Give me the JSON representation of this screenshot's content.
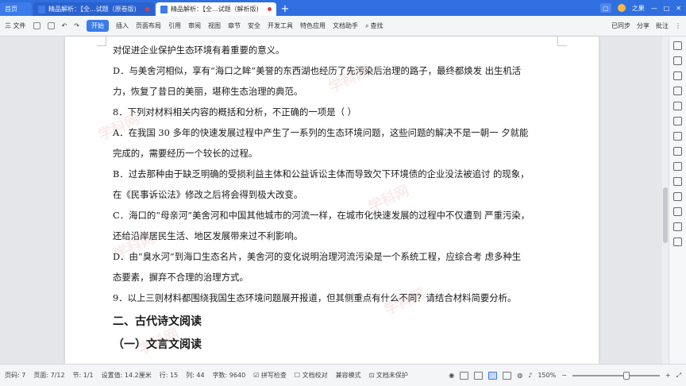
{
  "tabs": {
    "home": "首页",
    "doc1": "精品解析：【全...试题（原卷版)",
    "doc2": "精品解析：【全...试题（解析版)",
    "plus": "+",
    "user": "之果"
  },
  "menu": {
    "file": "三 文件",
    "items": [
      "开始",
      "插入",
      "页面布局",
      "引用",
      "审阅",
      "视图",
      "章节",
      "安全",
      "开发工具",
      "特色应用",
      "文档助手"
    ],
    "search": "查找",
    "right": [
      "已同步",
      "分享",
      "批注"
    ]
  },
  "document": {
    "lines": [
      "对促进企业保护生态环境有着重要的意义。",
      "D．与美舍河相似，享有“海口之眸”美誉的东西湖也经历了先污染后治理的路子，最终都焕发 出生机活",
      "力，恢复了昔日的美丽，堪称生态治理的典范。",
      "8．下列对材料相关内容的概括和分析，不正确的一项是（      ）",
      "A．在我国 30 多年的快速发展过程中产生了一系列的生态环境问题，这些问题的解决不是一朝一 夕就能",
      "完成的，需要经历一个较长的过程。",
      "B．过去那种由于缺乏明确的受损利益主体和公益诉讼主体而导致欠下环境债的企业没法被追讨 的现象，",
      "在《民事诉讼法》修改之后将会得到极大改变。",
      "C．海口的“母亲河”美舍河和中国其他城市的河流一样，在城市化快速发展的过程中不仅遭到 严重污染，",
      "还给沿岸居民生活、地区发展带来过不利影响。",
      "D．由“臭水河”到海口生态名片，美舍河的变化说明治理河流污染是一个系统工程，应综合考 虑多种生",
      "态要素，摒弃不合理的治理方式。",
      "9．以上三则材料都围绕我国生态环境问题展开报道，但其侧重点有什么不同？请结合材料简要分析。"
    ],
    "heading1": "二、古代诗文阅读",
    "heading2": "（一）文言文阅读",
    "watermark": "学科网"
  },
  "status": {
    "page": "页码: 7",
    "pages": "页面: 7/12",
    "section": "节: 1/1",
    "setting": "设置值: 14.2厘米",
    "row": "行: 15",
    "col": "列: 44",
    "words": "字数: 9640",
    "spell": "拼写检查",
    "proof": "文档校对",
    "compat": "兼容模式",
    "protect": "文档未保护",
    "zoom": "150%",
    "zoom_level": 0.62
  }
}
